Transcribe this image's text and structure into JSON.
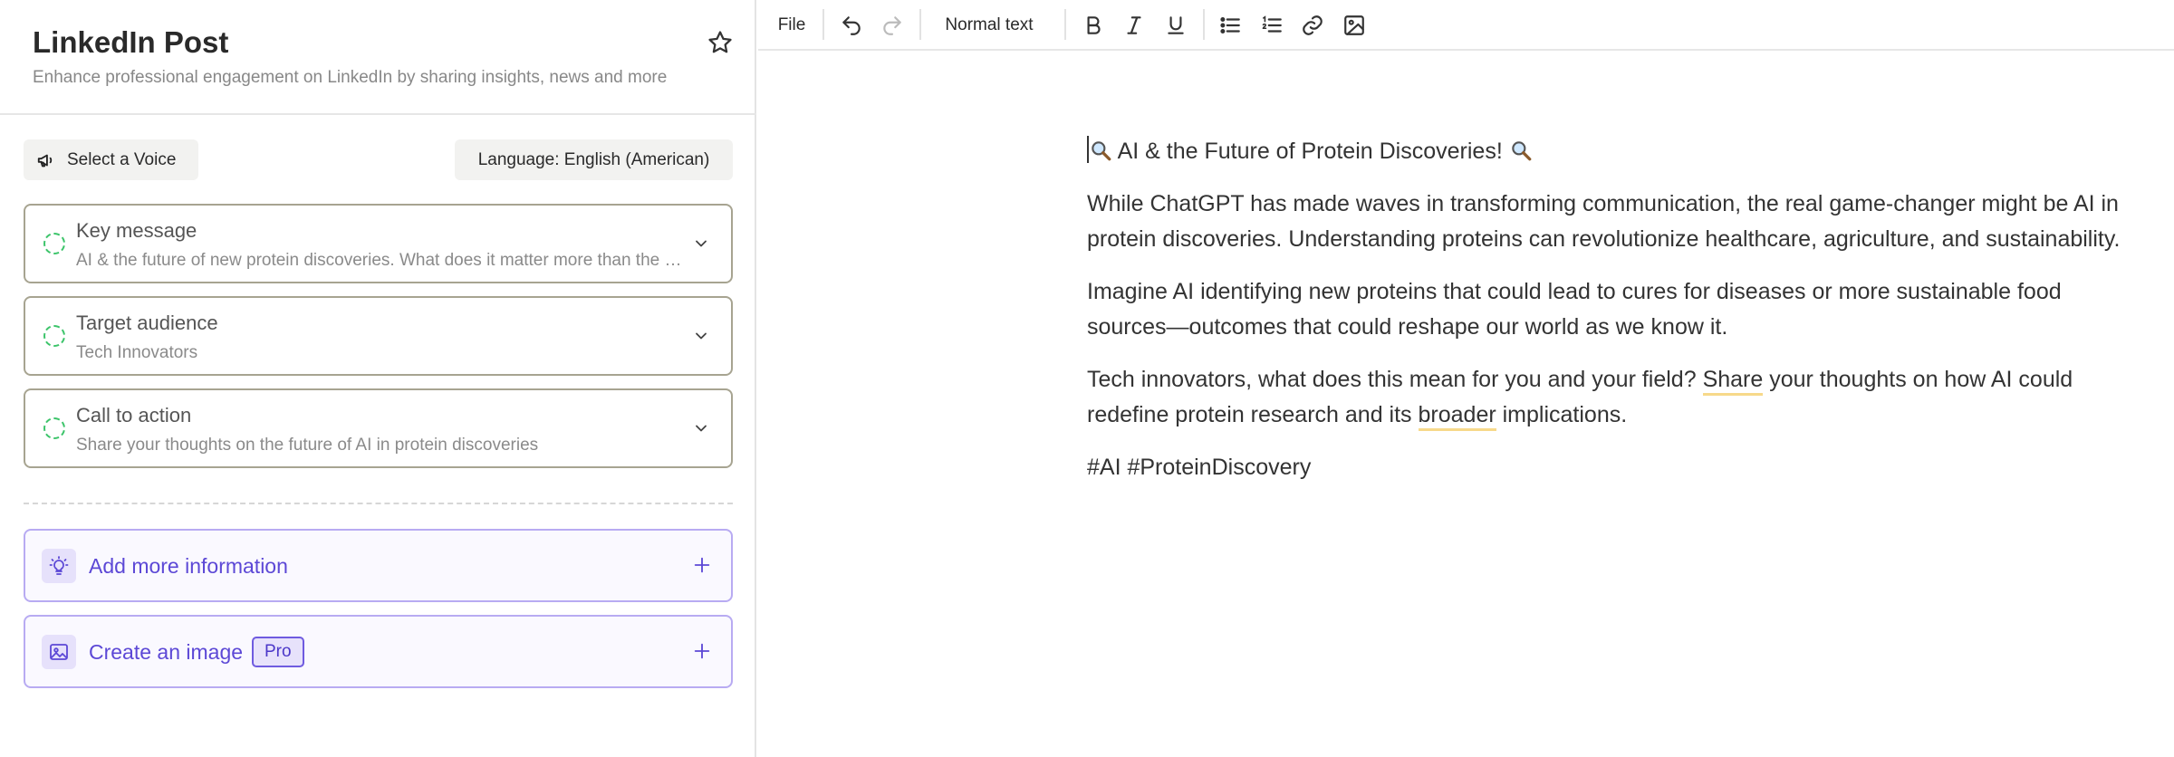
{
  "sidebar": {
    "title": "LinkedIn Post",
    "subtitle": "Enhance professional engagement on LinkedIn by sharing insights, news and more",
    "voice_label": "Select a Voice",
    "language_label": "Language: English (American)",
    "cards": [
      {
        "title": "Key message",
        "value": "AI & the future of new protein discoveries. What does it matter more than the latest ChatGPT model?"
      },
      {
        "title": "Target audience",
        "value": "Tech Innovators"
      },
      {
        "title": "Call to action",
        "value": "Share your thoughts on the future of AI in protein discoveries"
      }
    ],
    "actions": [
      {
        "label": "Add more information"
      },
      {
        "label": "Create an image",
        "badge": "Pro"
      }
    ]
  },
  "toolbar": {
    "file_label": "File",
    "style_label": "Normal text"
  },
  "document": {
    "heading": "AI & the Future of Protein Discoveries!",
    "paragraph1": "While ChatGPT has made waves in transforming communication, the real game-changer might be AI in protein discoveries. Understanding proteins can revolutionize healthcare, agriculture, and sustainability.",
    "paragraph2": "Imagine AI identifying new proteins that could lead to cures for diseases or more sustainable food sources—outcomes that could reshape our world as we know it.",
    "paragraph3_part1": "Tech innovators, what does this mean for you and your field? ",
    "paragraph3_highlight1": "Share",
    "paragraph3_part2": " your thoughts on how AI could redefine protein research and its ",
    "paragraph3_highlight2": "broader",
    "paragraph3_part3": " implications.",
    "hashtags": "#AI #ProteinDiscovery"
  },
  "colors": {
    "accent": "#5c48d6",
    "card_border": "#a7a491",
    "status_green": "#3cc46a",
    "highlight": "#f7d98a"
  }
}
